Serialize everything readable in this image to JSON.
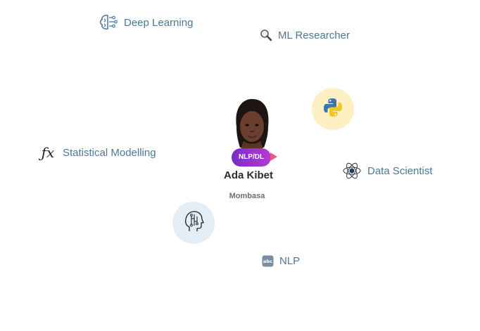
{
  "profile": {
    "name": "Ada Kibet",
    "location": "Mombasa",
    "badge": "NLP/DL"
  },
  "skills": {
    "deep_learning": "Deep Learning",
    "ml_researcher": "ML Researcher",
    "statistical_modelling": "Statistical Modelling",
    "data_scientist": "Data Scientist",
    "nlp": "NLP"
  },
  "icons": {
    "deep_learning": "brain-circuit-icon",
    "ml_researcher": "magnifier-icon",
    "statistical_modelling": "function-fx-icon",
    "data_scientist": "atom-icon",
    "nlp": "abc-icon",
    "python": "python-logo-icon",
    "ai_head": "ai-head-icon"
  },
  "colors": {
    "skill_text": "#4a7a96",
    "python_bubble": "#fdf0c2",
    "ai_bubble": "#e3eef7",
    "badge_start": "#7b2cc8",
    "badge_end": "#b13bd0"
  }
}
